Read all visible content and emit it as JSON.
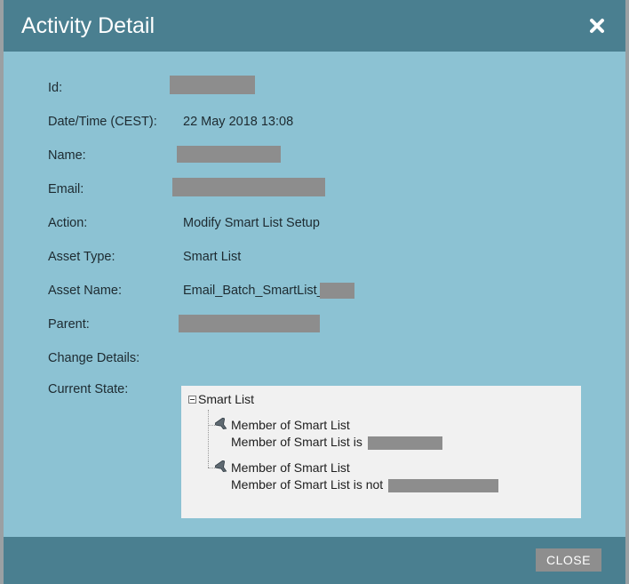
{
  "dialog": {
    "title": "Activity Detail",
    "close_icon": "close-x-icon"
  },
  "fields": {
    "id_label": "Id:",
    "datetime_label": "Date/Time (CEST):",
    "datetime_value": "22 May 2018 13:08",
    "name_label": "Name:",
    "email_label": "Email:",
    "action_label": "Action:",
    "action_value": "Modify Smart List Setup",
    "asset_type_label": "Asset Type:",
    "asset_type_value": "Smart List",
    "asset_name_label": "Asset Name:",
    "asset_name_value": "Email_Batch_SmartList_",
    "parent_label": "Parent:",
    "change_details_label": "Change Details:",
    "current_state_label": "Current State:"
  },
  "current_state": {
    "root_label": "Smart List",
    "filters": [
      {
        "title": "Member of Smart List",
        "condition": "Member of Smart List is",
        "icon": "filter-funnel-icon"
      },
      {
        "title": "Member of Smart List",
        "condition": "Member of Smart List is not",
        "icon": "filter-funnel-icon"
      }
    ]
  },
  "footer": {
    "close_label": "CLOSE"
  },
  "colors": {
    "header": "#4a7f90",
    "body": "#8cc2d3",
    "redaction": "#8d8d8d",
    "close_button": "#8e8e8e"
  }
}
